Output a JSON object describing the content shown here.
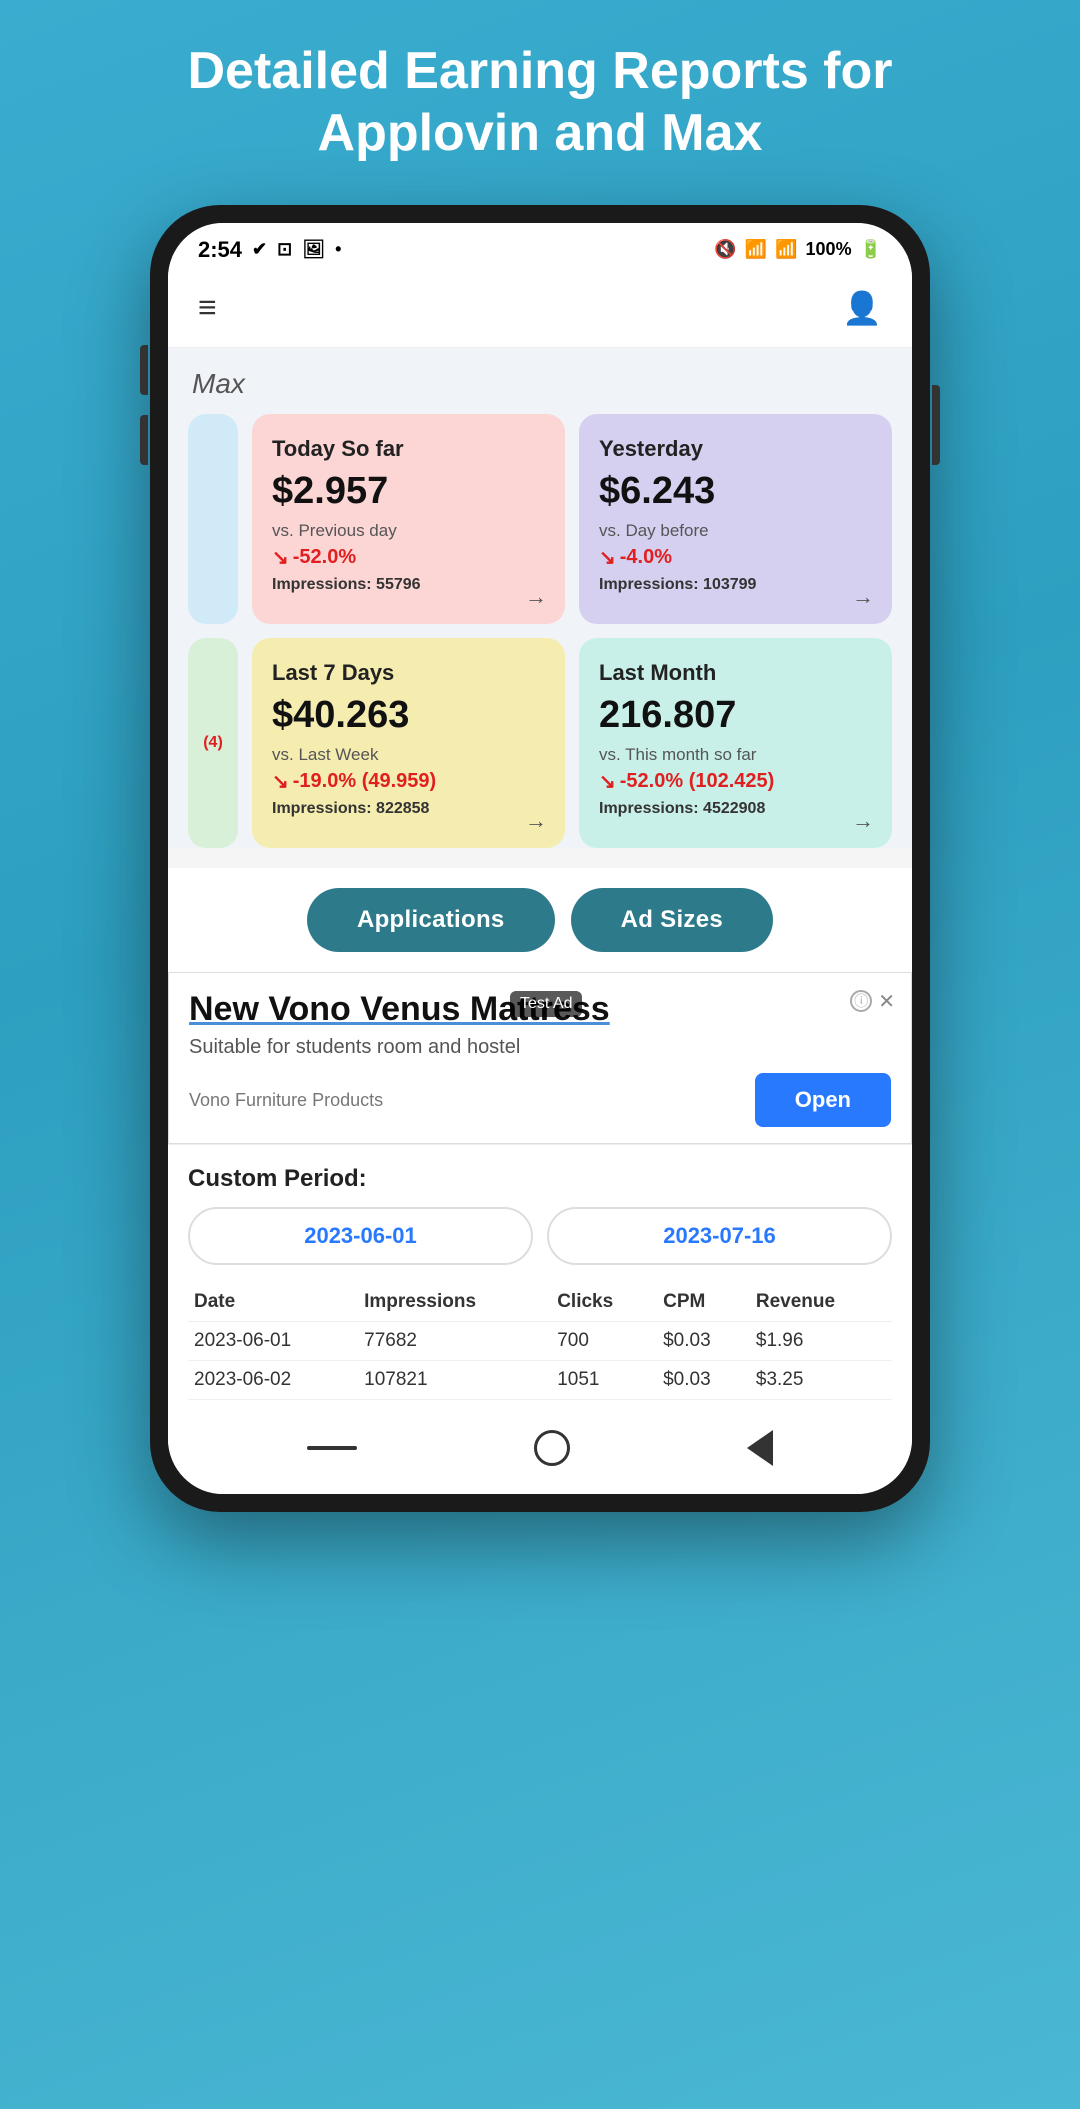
{
  "header": {
    "title_line1": "Detailed Earning Reports for",
    "title_line2": "Applovin and Max"
  },
  "status_bar": {
    "time": "2:54",
    "battery": "100%"
  },
  "nav": {
    "brand_label": "Max"
  },
  "cards": {
    "today": {
      "title": "Today So far",
      "amount": "$2.957",
      "vs_label": "vs. Previous day",
      "change": "-52.0%",
      "impressions_label": "Impressions:",
      "impressions_value": "55796"
    },
    "yesterday": {
      "title": "Yesterday",
      "amount": "$6.243",
      "vs_label": "vs. Day before",
      "change": "-4.0%",
      "impressions_label": "Impressions:",
      "impressions_value": "103799"
    },
    "last7": {
      "title": "Last 7 Days",
      "amount": "$40.263",
      "vs_label": "vs. Last Week",
      "change": "-19.0% (49.959)",
      "impressions_label": "Impressions:",
      "impressions_value": "822858"
    },
    "last_month": {
      "title": "Last Month",
      "amount": "216.807",
      "vs_label": "vs. This month so far",
      "change": "-52.0% (102.425)",
      "impressions_label": "Impressions:",
      "impressions_value": "4522908"
    }
  },
  "buttons": {
    "applications": "Applications",
    "ad_sizes": "Ad Sizes"
  },
  "ad": {
    "test_badge": "Test Ad",
    "title_part1": "New Vono Ve",
    "title_part2": "nus Mattress",
    "subtitle": "Suitable for students room and hostel",
    "brand": "Vono Furniture Products",
    "open_btn": "Open"
  },
  "custom_period": {
    "title": "Custom Period:",
    "date_start": "2023-06-01",
    "date_end": "2023-07-16"
  },
  "table": {
    "headers": [
      "Date",
      "Impressions",
      "Clicks",
      "CPM",
      "Revenue"
    ],
    "rows": [
      [
        "2023-06-01",
        "77682",
        "700",
        "$0.03",
        "$1.96"
      ],
      [
        "2023-06-02",
        "107821",
        "1051",
        "$0.03",
        "$3.25"
      ]
    ]
  },
  "side_stub_text": "(4)"
}
